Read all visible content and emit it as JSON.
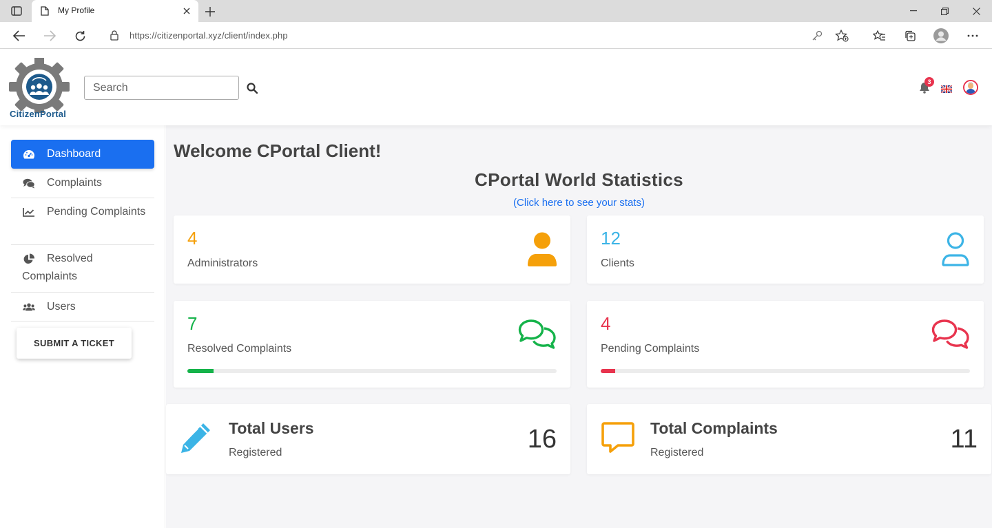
{
  "browser": {
    "tab_title": "My Profile",
    "url": "https://citizenportal.xyz/client/index.php"
  },
  "header": {
    "logo_text": "CitizenPortal",
    "search_placeholder": "Search",
    "notification_count": "3"
  },
  "sidebar": {
    "items": [
      {
        "label": "Dashboard",
        "icon": "dashboard-gauge-icon",
        "active": true
      },
      {
        "label": "Complaints",
        "icon": "comments-icon"
      },
      {
        "label": "Pending Complaints",
        "icon": "line-chart-icon"
      },
      {
        "label": "Resolved Complaints",
        "icon": "pie-chart-icon"
      },
      {
        "label": "Users",
        "icon": "users-icon"
      }
    ],
    "ticket_button": "SUBMIT A TICKET"
  },
  "main": {
    "welcome": "Welcome CPortal Client!",
    "stats_title": "CPortal World Statistics",
    "stats_link": "(Click here to see your stats)",
    "cards": {
      "administrators": {
        "value": "4",
        "label": "Administrators",
        "color": "#f5a00a",
        "icon": "user-solid-icon"
      },
      "clients": {
        "value": "12",
        "label": "Clients",
        "color": "#3cb4e6",
        "icon": "user-outline-icon"
      },
      "resolved": {
        "value": "7",
        "label": "Resolved Complaints",
        "color": "#15b34a",
        "icon": "comments-outline-icon",
        "progress_percent": 7
      },
      "pending": {
        "value": "4",
        "label": "Pending Complaints",
        "color": "#e8344e",
        "icon": "comments-outline-icon",
        "progress_percent": 4
      }
    },
    "totals": {
      "users": {
        "title": "Total Users",
        "subtitle": "Registered",
        "value": "16",
        "icon": "pencil-icon",
        "color": "#3cb4e6"
      },
      "complaints": {
        "title": "Total Complaints",
        "subtitle": "Registered",
        "value": "11",
        "icon": "speech-bubble-icon",
        "color": "#f5a00a"
      }
    }
  }
}
